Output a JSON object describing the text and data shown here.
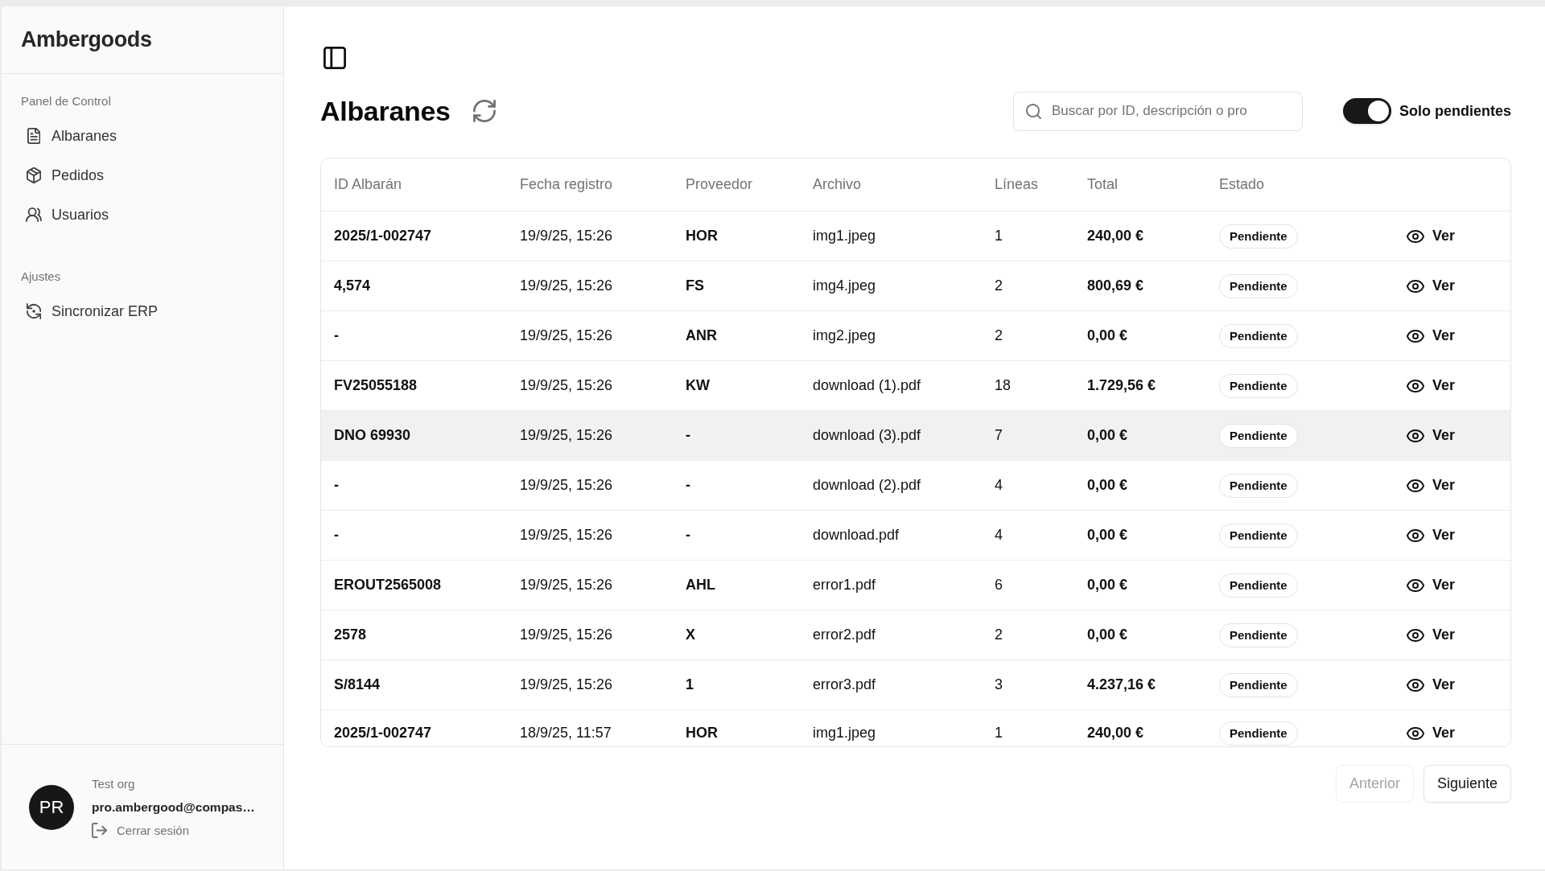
{
  "sidebar": {
    "brand": "Ambergoods",
    "sections": [
      {
        "title": "Panel de Control",
        "items": [
          {
            "label": "Albaranes"
          },
          {
            "label": "Pedidos"
          },
          {
            "label": "Usuarios"
          }
        ]
      },
      {
        "title": "Ajustes",
        "items": [
          {
            "label": "Sincronizar ERP"
          }
        ]
      }
    ],
    "user": {
      "initials": "PR",
      "organization": "Test org",
      "email": "pro.ambergood@compas…",
      "logout": "Cerrar sesión"
    }
  },
  "header": {
    "title": "Albaranes",
    "search": {
      "placeholder": "Buscar por ID, descripción o pro"
    },
    "filter_toggle": {
      "label": "Solo pendientes",
      "on": true
    }
  },
  "table": {
    "columns": [
      "ID Albarán",
      "Fecha registro",
      "Proveedor",
      "Archivo",
      "Líneas",
      "Total",
      "Estado"
    ],
    "rows": [
      {
        "id": "2025/1-002747",
        "date": "19/9/25, 15:26",
        "supplier": "HOR",
        "file": "img1.jpeg",
        "lines": "1",
        "total": "240,00 €",
        "status": "Pendiente",
        "action": "Ver",
        "hovered": false
      },
      {
        "id": "4,574",
        "date": "19/9/25, 15:26",
        "supplier": "FS",
        "file": "img4.jpeg",
        "lines": "2",
        "total": "800,69 €",
        "status": "Pendiente",
        "action": "Ver",
        "hovered": false
      },
      {
        "id": "-",
        "date": "19/9/25, 15:26",
        "supplier": "ANR",
        "file": "img2.jpeg",
        "lines": "2",
        "total": "0,00 €",
        "status": "Pendiente",
        "action": "Ver",
        "hovered": false
      },
      {
        "id": "FV25055188",
        "date": "19/9/25, 15:26",
        "supplier": "KW",
        "file": "download (1).pdf",
        "lines": "18",
        "total": "1.729,56 €",
        "status": "Pendiente",
        "action": "Ver",
        "hovered": false
      },
      {
        "id": "DNO 69930",
        "date": "19/9/25, 15:26",
        "supplier": "-",
        "file": "download (3).pdf",
        "lines": "7",
        "total": "0,00 €",
        "status": "Pendiente",
        "action": "Ver",
        "hovered": true
      },
      {
        "id": "-",
        "date": "19/9/25, 15:26",
        "supplier": "-",
        "file": "download (2).pdf",
        "lines": "4",
        "total": "0,00 €",
        "status": "Pendiente",
        "action": "Ver",
        "hovered": false
      },
      {
        "id": "-",
        "date": "19/9/25, 15:26",
        "supplier": "-",
        "file": "download.pdf",
        "lines": "4",
        "total": "0,00 €",
        "status": "Pendiente",
        "action": "Ver",
        "hovered": false
      },
      {
        "id": "EROUT2565008",
        "date": "19/9/25, 15:26",
        "supplier": "AHL",
        "file": "error1.pdf",
        "lines": "6",
        "total": "0,00 €",
        "status": "Pendiente",
        "action": "Ver",
        "hovered": false
      },
      {
        "id": "2578",
        "date": "19/9/25, 15:26",
        "supplier": "X",
        "file": "error2.pdf",
        "lines": "2",
        "total": "0,00 €",
        "status": "Pendiente",
        "action": "Ver",
        "hovered": false
      },
      {
        "id": "S/8144",
        "date": "19/9/25, 15:26",
        "supplier": "1",
        "file": "error3.pdf",
        "lines": "3",
        "total": "4.237,16 €",
        "status": "Pendiente",
        "action": "Ver",
        "hovered": false
      },
      {
        "id": "2025/1-002747",
        "date": "18/9/25, 11:57",
        "supplier": "HOR",
        "file": "img1.jpeg",
        "lines": "1",
        "total": "240,00 €",
        "status": "Pendiente",
        "action": "Ver",
        "hovered": false
      }
    ]
  },
  "pagination": [
    {
      "label": "Anterior",
      "disabled": true
    },
    {
      "label": "Siguiente",
      "disabled": false
    }
  ]
}
